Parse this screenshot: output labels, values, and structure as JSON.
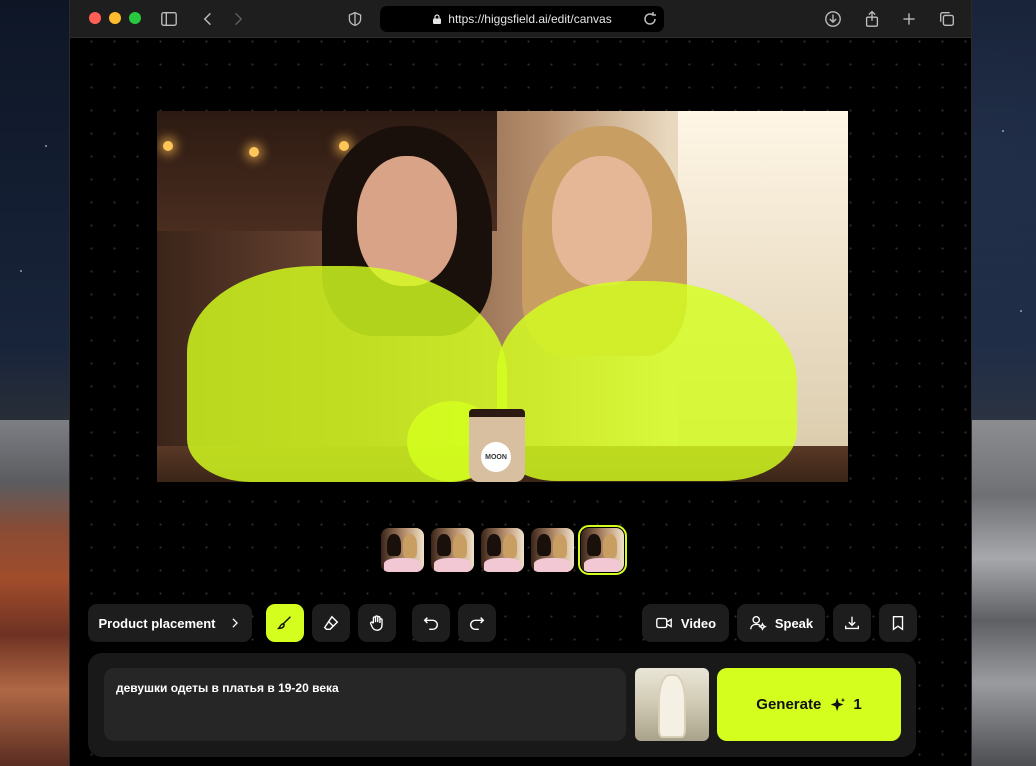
{
  "browser": {
    "url": "https://higgsfield.ai/edit/canvas"
  },
  "canvas": {
    "main_image_alt": "two women at cafe with masked clothing",
    "cup_logo": "MOON",
    "thumbnails": [
      {
        "index": 1,
        "selected": false
      },
      {
        "index": 2,
        "selected": false
      },
      {
        "index": 3,
        "selected": false
      },
      {
        "index": 4,
        "selected": false
      },
      {
        "index": 5,
        "selected": true
      }
    ]
  },
  "toolbar": {
    "product_placement_label": "Product placement",
    "video_label": "Video",
    "speak_label": "Speak",
    "tools": [
      "brush-icon",
      "eraser-icon",
      "hand-icon",
      "undo-icon",
      "redo-icon"
    ],
    "active_tool": "brush-icon"
  },
  "prompt": {
    "text": "девушки одеты в платья в 19-20 века",
    "generate_label": "Generate",
    "credits": "1"
  },
  "colors": {
    "accent": "#d4ff1e",
    "panel": "#191919",
    "button": "#1d1d1d"
  }
}
